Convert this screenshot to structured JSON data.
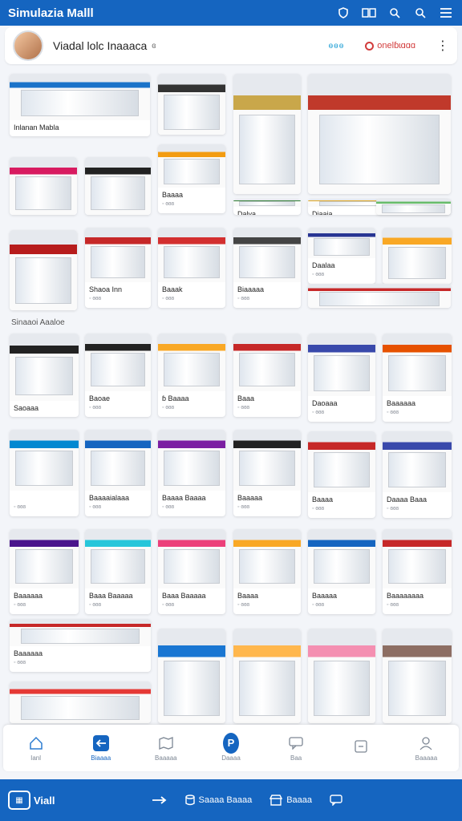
{
  "app": {
    "title": "Simulazia Malll"
  },
  "profile": {
    "name": "Viadal lolc Inaaaca",
    "name_extra": "ɞ",
    "status": "ɵɵɵ",
    "brand": "onelɓɩɑɑɑ"
  },
  "section": {
    "label": "Sinaaoi Aaaloe"
  },
  "cards": [
    {
      "label": "Inlanan Mabla",
      "meta": "",
      "color": "#1b73c9"
    },
    {
      "label": "",
      "meta": "",
      "color": "#333"
    },
    {
      "label": "",
      "meta": "",
      "color": "#c9a74a"
    },
    {
      "label": "",
      "meta": "",
      "color": "#c0392b"
    },
    {
      "label": "",
      "meta": "",
      "color": "#d81b60"
    },
    {
      "label": "",
      "meta": "",
      "color": "#222"
    },
    {
      "label": "Baaaa",
      "meta": "◦ ɞɞɞ",
      "color": "#f39c12"
    },
    {
      "label": "Dalva",
      "meta": "",
      "color": "#2e7d32"
    },
    {
      "label": "Diaaia",
      "meta": "",
      "color": "#e0a722"
    },
    {
      "label": "",
      "meta": "",
      "color": "#b71c1c"
    },
    {
      "label": "Shaoa Inn",
      "meta": "◦ ɞɞɞ",
      "color": "#c62828"
    },
    {
      "label": "Baaak",
      "meta": "◦ ɞɞɞ",
      "color": "#d32f2f"
    },
    {
      "label": "Biaaaaa",
      "meta": "◦ ɞɞɞ",
      "color": "#444"
    },
    {
      "label": "Daalaa",
      "meta": "◦ ɞɞɞ",
      "color": "#283593"
    },
    {
      "label": "",
      "meta": "",
      "color": "#f9a825"
    },
    {
      "label": "Saoaaa",
      "meta": "",
      "color": "#222"
    },
    {
      "label": "Baoae",
      "meta": "◦ ɞɞɞ",
      "color": "#222"
    },
    {
      "label": "ɓ Baaaa",
      "meta": "◦ ɞɞɞ",
      "color": "#f9a825"
    },
    {
      "label": "Baaa",
      "meta": "◦ ɞɞɞ",
      "color": "#c62828"
    },
    {
      "label": "Daoaaa",
      "meta": "◦ ɞɞɞ",
      "color": "#3949ab"
    },
    {
      "label": "Baaaaaa",
      "meta": "◦ ɞɞɞ",
      "color": "#e65100"
    },
    {
      "label": "",
      "meta": "◦ ɞɞɞ",
      "color": "#0288d1"
    },
    {
      "label": "Baaaaialaaa",
      "meta": "◦ ɞɞɞ",
      "color": "#1565c0"
    },
    {
      "label": "Baaaa Baaaa",
      "meta": "◦ ɞɞɞ",
      "color": "#7b1fa2"
    },
    {
      "label": "Baaaaa",
      "meta": "◦ ɞɞɞ",
      "color": "#222"
    },
    {
      "label": "Baaaa",
      "meta": "◦ ɞɞɞ",
      "color": "#c62828"
    },
    {
      "label": "Daaaa Baaa",
      "meta": "◦ ɞɞɞ",
      "color": "#3949ab"
    },
    {
      "label": "Baaaaaa",
      "meta": "◦ ɞɞɞ",
      "color": "#4a148c"
    },
    {
      "label": "Baaa Baaaaa",
      "meta": "◦ ɞɞɞ",
      "color": "#26c6da"
    },
    {
      "label": "Baaa Baaaaa",
      "meta": "◦ ɞɞɞ",
      "color": "#ec407a"
    },
    {
      "label": "Baaaa",
      "meta": "◦ ɞɞɞ",
      "color": "#f9a825"
    },
    {
      "label": "Baaaaa",
      "meta": "◦ ɞɞɞ",
      "color": "#1565c0"
    },
    {
      "label": "Baaaaaaaa",
      "meta": "◦ ɞɞɞ",
      "color": "#c62828"
    },
    {
      "label": "Baaaaaa",
      "meta": "◦ ɞɞɞ",
      "color": "#c62828"
    },
    {
      "label": "",
      "meta": "",
      "color": "#e53935"
    },
    {
      "label": "",
      "meta": "",
      "color": "#1976d2"
    },
    {
      "label": "",
      "meta": "",
      "color": "#ffb74d"
    },
    {
      "label": "",
      "meta": "",
      "color": "#f48fb1"
    },
    {
      "label": "",
      "meta": "",
      "color": "#8d6e63"
    },
    {
      "label": "",
      "meta": "",
      "color": "#66bb6a"
    },
    {
      "label": "",
      "meta": "",
      "color": "#c62828"
    }
  ],
  "bottom_nav": [
    {
      "label": "Ianl",
      "icon": "home-icon",
      "active": false
    },
    {
      "label": "Biaaaa",
      "icon": "back-arrow-icon",
      "active": true
    },
    {
      "label": "Baaaaa",
      "icon": "map-icon",
      "active": false
    },
    {
      "label": "Daaaa",
      "icon": "pin-icon",
      "active": false
    },
    {
      "label": "Baa",
      "icon": "chat-icon",
      "active": false
    },
    {
      "label": "",
      "icon": "note-icon",
      "active": false
    },
    {
      "label": "Baaaaa",
      "icon": "user-icon",
      "active": false
    }
  ],
  "footer": {
    "logo": "Viall",
    "item1": "Saaaa Baaaa",
    "item2": "Baaaa"
  }
}
